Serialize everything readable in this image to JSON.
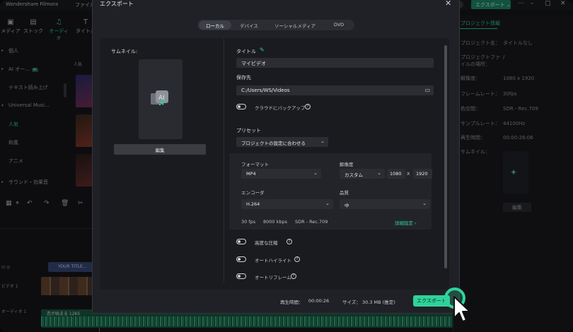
{
  "app": {
    "title": "Wondershare Filmora",
    "menu_file": "ファイル",
    "top_export": "エクスポート ⌄",
    "tabs": [
      {
        "label": "メディア",
        "icon": "media-icon"
      },
      {
        "label": "ストック",
        "icon": "stock-icon"
      },
      {
        "label": "オーディオ",
        "icon": "music-note-icon"
      },
      {
        "label": "タイトル",
        "icon": "title-icon"
      }
    ],
    "sidebar": {
      "items": [
        {
          "label": "個人"
        },
        {
          "label": "AI オー...",
          "badge": "AI"
        },
        {
          "label": "テキスト読み上げ"
        },
        {
          "label": "Universal Musi..."
        },
        {
          "label": "人気"
        },
        {
          "label": "和風"
        },
        {
          "label": "アニメ"
        },
        {
          "label": "サウンド・効果音"
        }
      ]
    },
    "thumb_label": "人気",
    "timeline": {
      "title_clip": "YOUR TITLE...",
      "video_track_label": "ビデオ 1",
      "audio_track_label": "オーディオ 1",
      "audio_clip": "恋が始まる 1265"
    },
    "project_info": {
      "tab": "プロジェクト情報",
      "rows": [
        {
          "key": "プロジェクト名：",
          "value": "タイトルなし"
        },
        {
          "key": "プロジェクトファイルの場所：",
          "value": "/"
        },
        {
          "key": "解像度：",
          "value": "1080 x 1920"
        },
        {
          "key": "フレームレート：",
          "value": "30fps"
        },
        {
          "key": "色空間：",
          "value": "SDR - Rec.709"
        },
        {
          "key": "サンプルレート：",
          "value": "44100Hz"
        },
        {
          "key": "再生時間：",
          "value": "00:00:26:06"
        },
        {
          "key": "サムネイル：",
          "value": ""
        }
      ],
      "edit": "編集"
    }
  },
  "dialog": {
    "title": "エクスポート",
    "tabs": [
      "ローカル",
      "デバイス",
      "ソーシャルメディア",
      "DVD"
    ],
    "active_tab": "ローカル",
    "thumbnail_label": "サムネイル:",
    "edit_button": "編集",
    "title_label": "タイトル",
    "title_value": "マイビデオ",
    "save_label": "保存先",
    "save_path": "C:/Users/WS/Videos",
    "cloud_backup": "クラウドにバックアップ",
    "preset_label": "プリセット",
    "preset_value": "プロジェクトの設定に合わせる",
    "format_label": "フォーマット",
    "format_value": "MP4",
    "resolution_label": "解像度",
    "resolution_value": "カスタム",
    "res_width": "1080",
    "res_x": "X",
    "res_height": "1920",
    "encoder_label": "エンコーダ",
    "encoder_value": "H.264",
    "quality_label": "品質",
    "quality_value": "中",
    "fps": "30 fps",
    "bitrate": "8000 kbps",
    "colorspace": "SDR - Rec.709",
    "detail_link": "詳細設定 ›",
    "advanced_compress": "高度な圧縮",
    "auto_highlight": "オートハイライト",
    "auto_reframe": "オートリフレーム",
    "duration_label": "再生時間：",
    "duration_value": "00:00:26",
    "size_label": "サイズ：",
    "size_value": "30.3 MB (推定)",
    "export_button": "エクスポート"
  },
  "colors": {
    "accent": "#2fd39a",
    "dialog_bg": "#202126",
    "panel_bg": "#1a1b1f"
  }
}
